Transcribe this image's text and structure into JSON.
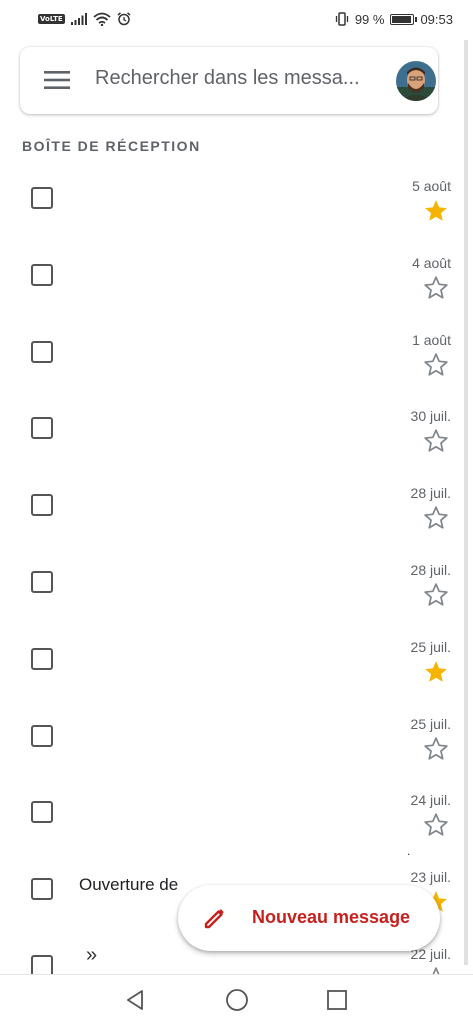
{
  "status_bar": {
    "volte": "VoLTE",
    "battery_percent": "99 %",
    "battery_level": 0.99,
    "time": "09:53"
  },
  "search": {
    "placeholder": "Rechercher dans les messa..."
  },
  "inbox": {
    "section_title": "BOÎTE DE RÉCEPTION",
    "rows": [
      {
        "date": "5 août",
        "starred": true
      },
      {
        "date": "4 août",
        "starred": false
      },
      {
        "date": "1 août",
        "starred": false
      },
      {
        "date": "30 juil.",
        "starred": false
      },
      {
        "date": "28 juil.",
        "starred": false
      },
      {
        "date": "28 juil.",
        "starred": false
      },
      {
        "date": "25 juil.",
        "starred": true
      },
      {
        "date": "25 juil.",
        "starred": false
      },
      {
        "date": "24 juil.",
        "starred": false,
        "dot": "."
      },
      {
        "date": "23 juil.",
        "starred": true,
        "snippet": "Ouverture de"
      },
      {
        "date": "22 juil.",
        "starred": false,
        "chevrons": "»"
      }
    ]
  },
  "fab": {
    "label": "Nouveau message"
  },
  "colors": {
    "accent": "#c5221f",
    "star": "#f4b400",
    "star_outline": "#80868b"
  }
}
